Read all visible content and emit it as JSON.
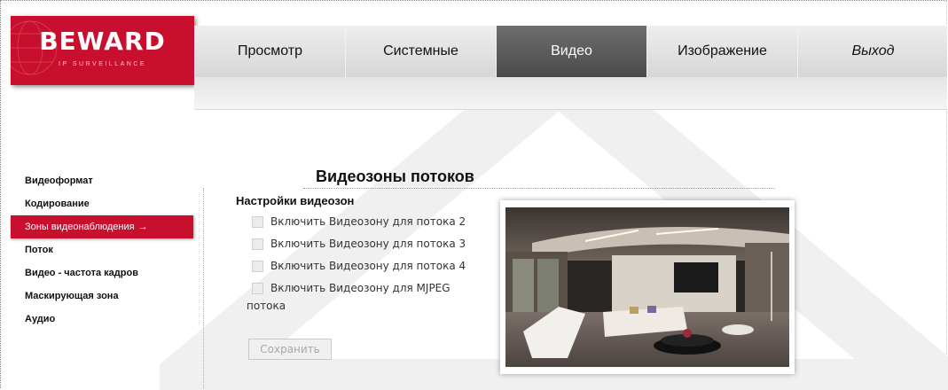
{
  "logo": {
    "brand": "BEWARD",
    "tagline": "IP SURVEILLANCE"
  },
  "nav": {
    "items": [
      {
        "label": "Просмотр",
        "active": false
      },
      {
        "label": "Системные",
        "active": false
      },
      {
        "label": "Видео",
        "active": true
      },
      {
        "label": "Изображение",
        "active": false
      },
      {
        "label": "Выход",
        "active": false
      }
    ]
  },
  "sidebar": {
    "items": [
      {
        "label": "Видеоформат"
      },
      {
        "label": "Кодирование"
      },
      {
        "label": "Зоны видеонаблюдения",
        "active": true,
        "arrow": "→"
      },
      {
        "label": "Поток"
      },
      {
        "label": "Видео - частота кадров"
      },
      {
        "label": "Маскирующая зона"
      },
      {
        "label": "Аудио"
      }
    ]
  },
  "main": {
    "title": "Видеозоны потоков",
    "section_title": "Настройки видеозон",
    "checkboxes": [
      {
        "label": "Включить Видеозону для потока 2",
        "checked": false
      },
      {
        "label": "Включить Видеозону для потока 3",
        "checked": false
      },
      {
        "label": "Включить Видеозону для потока 4",
        "checked": false
      },
      {
        "label": "Включить Видеозону для MJPEG",
        "checked": false
      }
    ],
    "last_checkbox_wrap": "потока",
    "save_label": "Сохранить"
  },
  "colors": {
    "accent": "#c8102e",
    "nav_active": "#555555"
  }
}
